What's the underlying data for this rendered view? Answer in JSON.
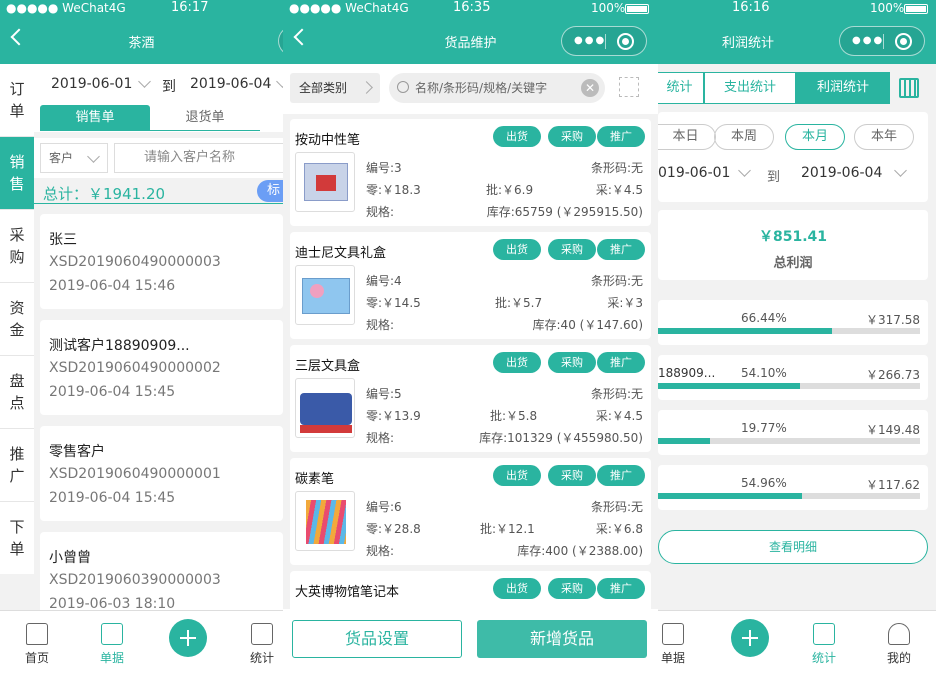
{
  "colors": {
    "accent": "#2ab4a0",
    "label_blue": "#6b9ef5"
  },
  "status": {
    "carrier": "●●●●● WeChat4G",
    "battery": "100%"
  },
  "screen1": {
    "time": "16:17",
    "title": "茶酒",
    "sidebar": [
      "订单",
      "销售",
      "采购",
      "资金",
      "盘点",
      "推广",
      "下单"
    ],
    "date_from": "2019-06-01",
    "date_to_label": "到",
    "date_to": "2019-06-04",
    "tabs": [
      "销售单",
      "退货单"
    ],
    "customer_select": "客户",
    "customer_placeholder": "请输入客户名称",
    "total": "总计：￥1941.20",
    "tag": "标",
    "orders": [
      {
        "name": "张三",
        "no": "XSD2019060490000003",
        "time": "2019-06-04 15:46"
      },
      {
        "name": "测试客户18890909...",
        "no": "XSD2019060490000002",
        "time": "2019-06-04 15:45"
      },
      {
        "name": "零售客户",
        "no": "XSD2019060490000001",
        "time": "2019-06-04 15:45"
      },
      {
        "name": "小曾曾",
        "no": "XSD2019060390000003",
        "time": "2019-06-03 18:10"
      }
    ],
    "tabbar": [
      "首页",
      "单据",
      "统计"
    ]
  },
  "screen2": {
    "time": "16:35",
    "title": "货品维护",
    "category": "全部类别",
    "search_placeholder": "名称/条形码/规格/关键字",
    "actions": [
      "出货",
      "采购",
      "推广"
    ],
    "products": [
      {
        "name": "按动中性笔",
        "code": "编号:3",
        "barcode": "条形码:无",
        "retail": "零:￥18.3",
        "wholesale": "批:￥6.9",
        "purchase": "采:￥4.5",
        "spec": "规格:",
        "stock": "库存:65759 (￥295915.50)"
      },
      {
        "name": "迪士尼文具礼盒",
        "code": "编号:4",
        "barcode": "条形码:无",
        "retail": "零:￥14.5",
        "wholesale": "批:￥5.7",
        "purchase": "采:￥3",
        "spec": "规格:",
        "stock": "库存:40 (￥147.60)"
      },
      {
        "name": "三层文具盒",
        "code": "编号:5",
        "barcode": "条形码:无",
        "retail": "零:￥13.9",
        "wholesale": "批:￥5.8",
        "purchase": "采:￥4.5",
        "spec": "规格:",
        "stock": "库存:101329 (￥455980.50)"
      },
      {
        "name": "碳素笔",
        "code": "编号:6",
        "barcode": "条形码:无",
        "retail": "零:￥28.8",
        "wholesale": "批:￥12.1",
        "purchase": "采:￥6.8",
        "spec": "规格:",
        "stock": "库存:400 (￥2388.00)"
      },
      {
        "name": "大英博物馆笔记本",
        "code": "",
        "barcode": "",
        "retail": "",
        "wholesale": "",
        "purchase": "",
        "spec": "",
        "stock": ""
      }
    ],
    "btn_settings": "货品设置",
    "btn_add": "新增货品"
  },
  "screen3": {
    "time": "16:16",
    "title": "利润统计",
    "battery": "100%",
    "seg": [
      "统计",
      "支出统计",
      "利润统计"
    ],
    "periods": [
      "本日",
      "本周",
      "本月",
      "本年"
    ],
    "date_from": "019-06-01",
    "date_to_label": "到",
    "date_to": "2019-06-04",
    "profit_value": "￥851.41",
    "profit_label": "总利润",
    "rows": [
      {
        "label": "",
        "percent_text": "66.44%",
        "percent": 66.44,
        "value": "￥317.58"
      },
      {
        "label": "188909...",
        "percent_text": "54.10%",
        "percent": 54.1,
        "value": "￥266.73"
      },
      {
        "label": "",
        "percent_text": "19.77%",
        "percent": 19.77,
        "value": "￥149.48"
      },
      {
        "label": "",
        "percent_text": "54.96%",
        "percent": 54.96,
        "value": "￥117.62"
      }
    ],
    "detail_button": "查看明细",
    "tabbar": [
      "单据",
      "统计",
      "我的"
    ]
  }
}
